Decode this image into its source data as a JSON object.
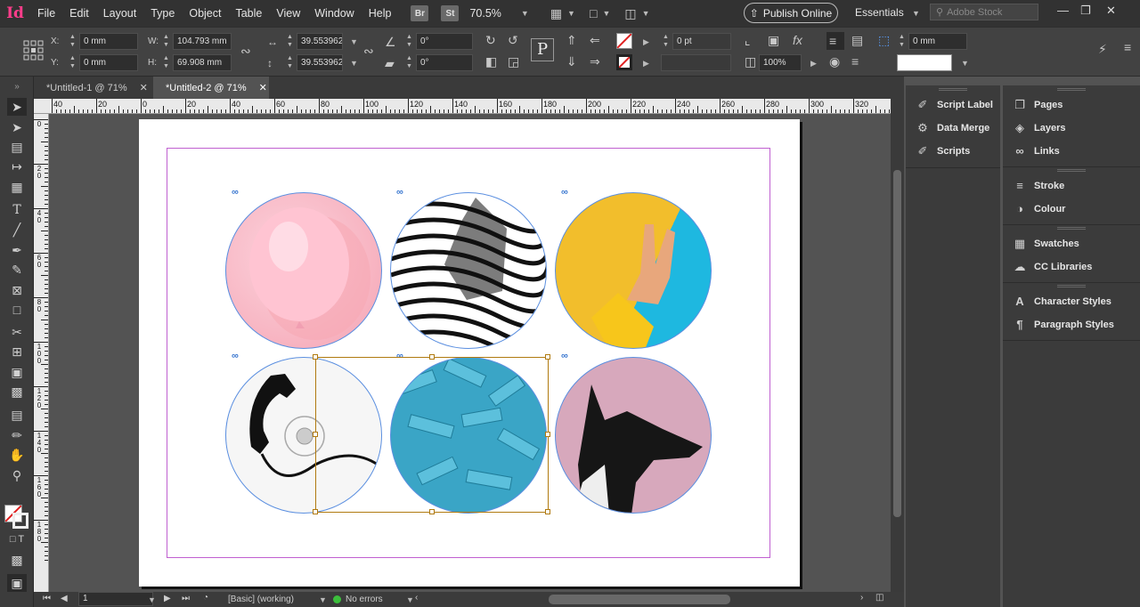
{
  "app": {
    "logo": "Id"
  },
  "menu": [
    "File",
    "Edit",
    "Layout",
    "Type",
    "Object",
    "Table",
    "View",
    "Window",
    "Help"
  ],
  "menubar": {
    "bridge": "Br",
    "stock_app": "St",
    "zoom": "70.5%",
    "publish": "Publish Online",
    "workspace": "Essentials",
    "search_placeholder": "Adobe Stock"
  },
  "control": {
    "x_label": "X:",
    "x": "0 mm",
    "y_label": "Y:",
    "y": "0 mm",
    "w_label": "W:",
    "w": "104.793 mm",
    "h_label": "H:",
    "h": "69.908 mm",
    "scale_x": "39.5539629",
    "scale_y": "39.5539629",
    "rotate": "0°",
    "shear": "0°",
    "stroke_weight": "0 pt",
    "opacity": "100%",
    "offset": "0 mm"
  },
  "tabs": [
    {
      "label": "*Untitled-1 @ 71%"
    },
    {
      "label": "*Untitled-2 @ 71%"
    }
  ],
  "ruler": {
    "h": [
      "40",
      "20",
      "0",
      "20",
      "40",
      "60",
      "80",
      "100",
      "120",
      "140",
      "160",
      "180",
      "200",
      "220",
      "240",
      "260",
      "280",
      "300",
      "320"
    ],
    "v": [
      "0",
      "20",
      "40",
      "60",
      "80",
      "100",
      "120",
      "140",
      "160",
      "180"
    ]
  },
  "status": {
    "page": "1",
    "style": "[Basic] (working)",
    "errors": "No errors"
  },
  "panels": {
    "left": [
      "Script Label",
      "Data Merge",
      "Scripts"
    ],
    "right": [
      "Pages",
      "Layers",
      "Links",
      "Stroke",
      "Colour",
      "Swatches",
      "CC Libraries",
      "Character Styles",
      "Paragraph Styles"
    ]
  },
  "colors": {
    "accent": "#ff3d8b",
    "selection": "#b07a10",
    "frame": "#5b8fe0",
    "margin": "#c060d0"
  }
}
